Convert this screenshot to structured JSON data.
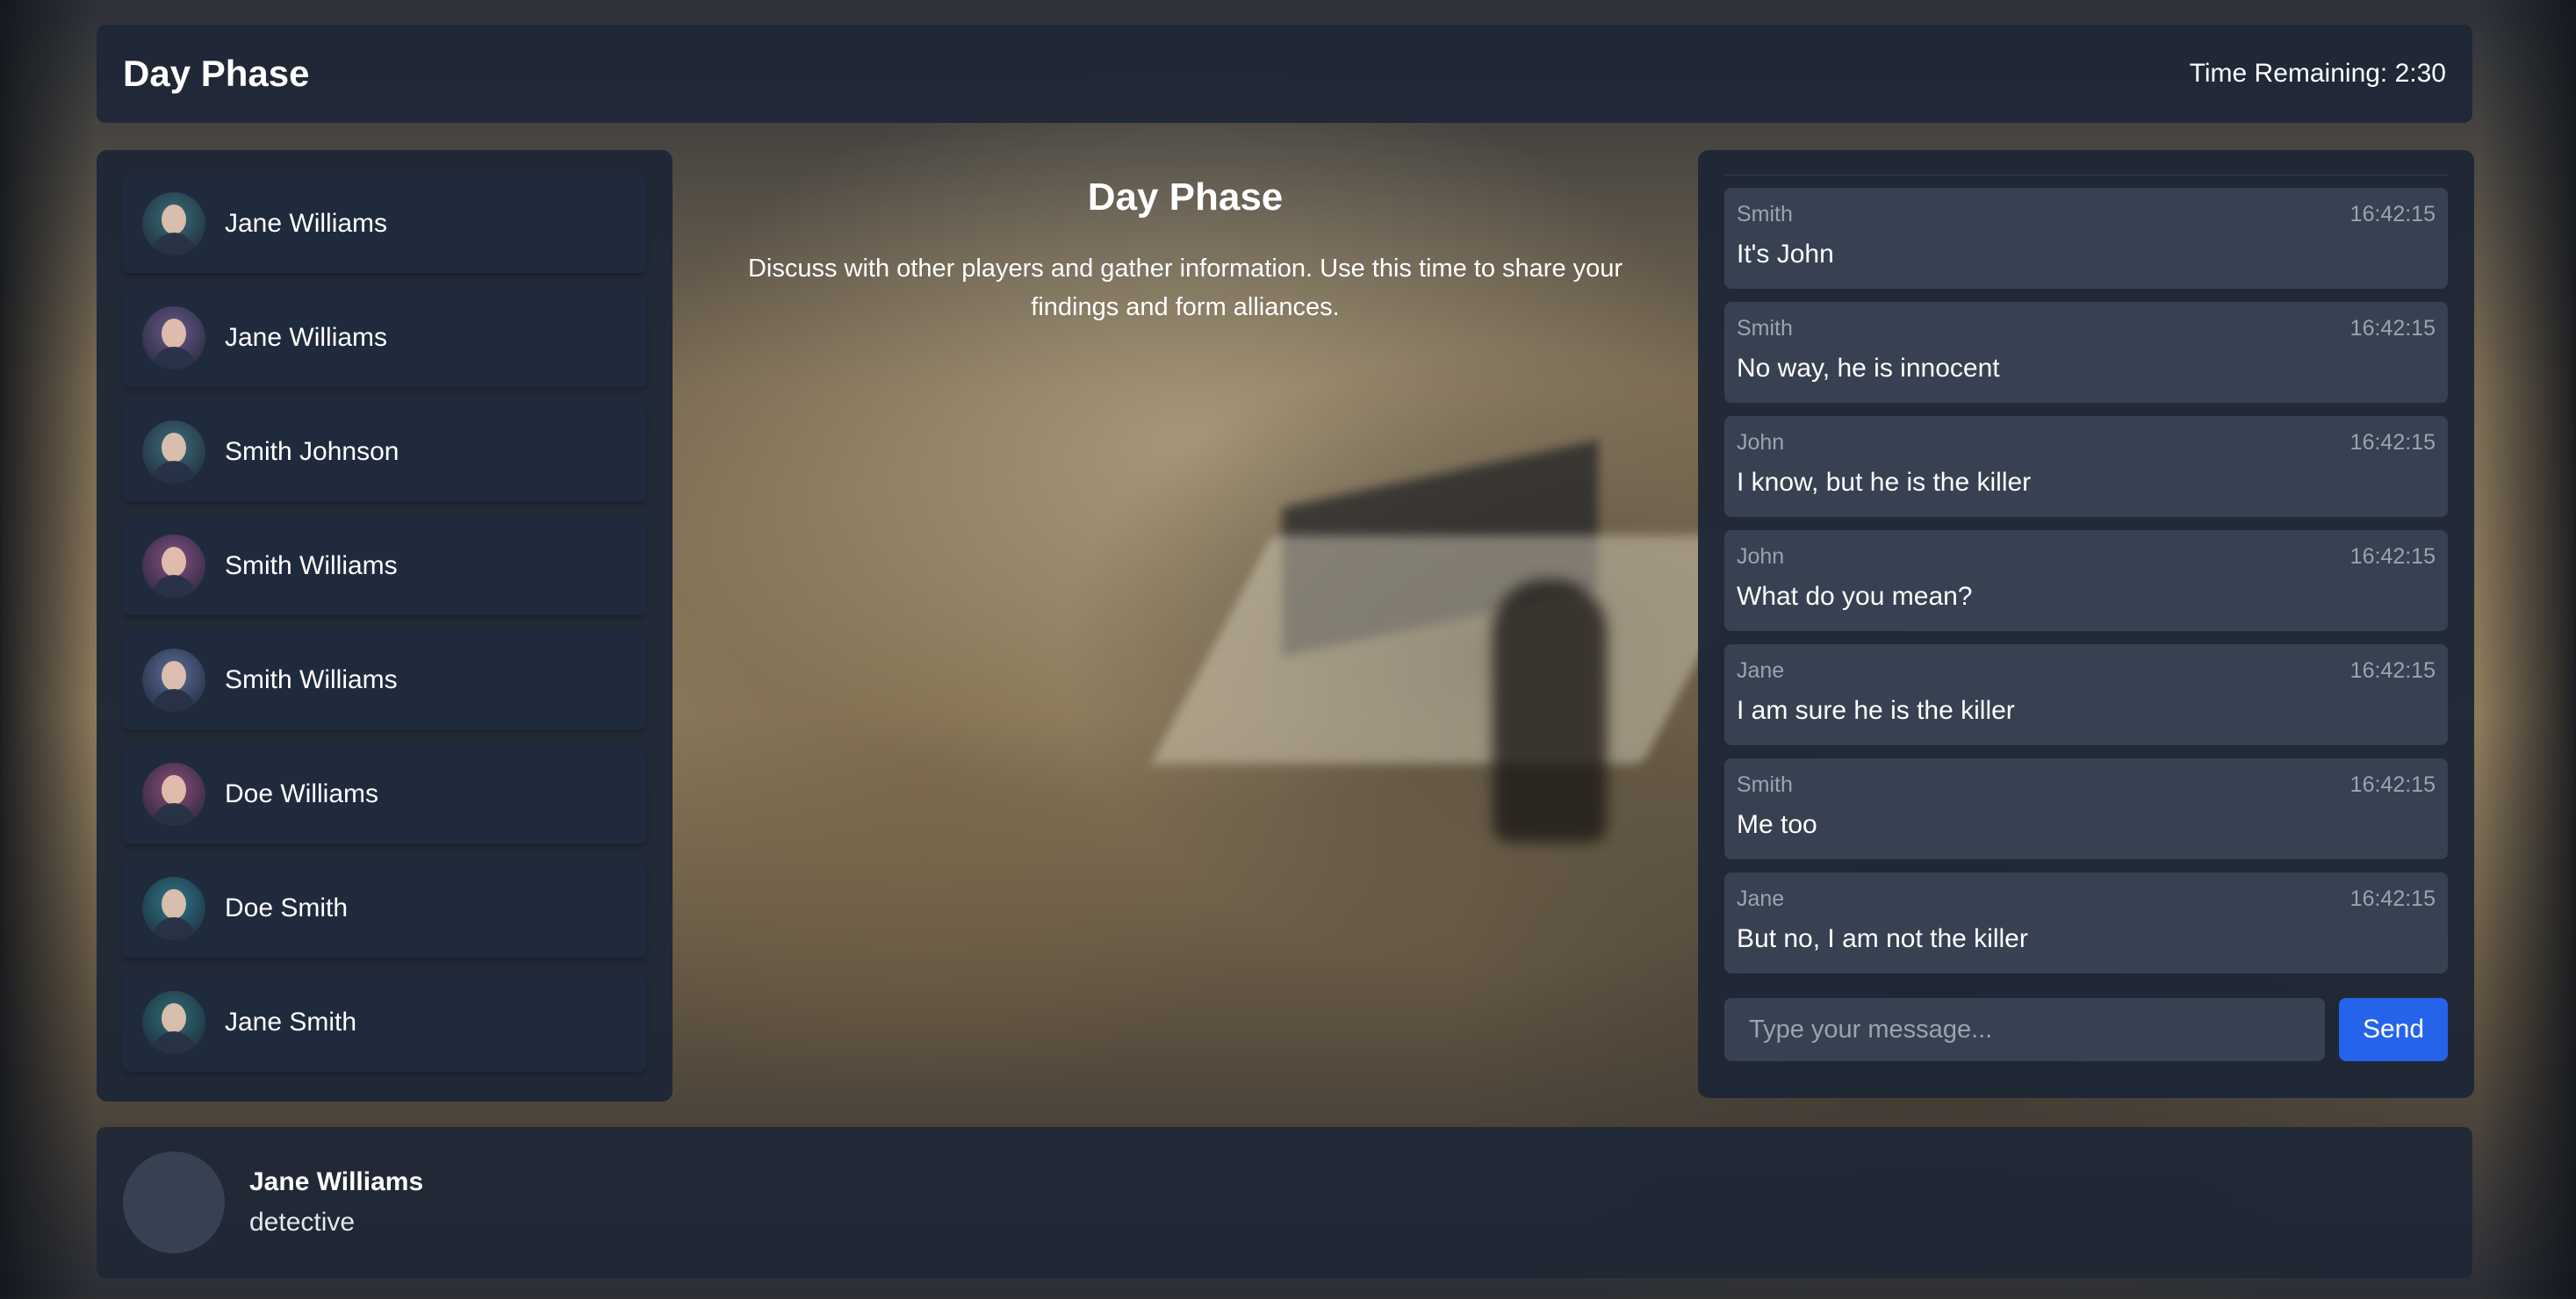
{
  "header": {
    "title": "Day Phase",
    "timer": "Time Remaining: 2:30"
  },
  "players": [
    {
      "name": "Jane Williams",
      "avatar_color": "#3a6f7a",
      "avatar_icon": "portrait-man-icon"
    },
    {
      "name": "Jane Williams",
      "avatar_color": "#6d5a8c",
      "avatar_icon": "portrait-woman-icon"
    },
    {
      "name": "Smith Johnson",
      "avatar_color": "#3f6e7c",
      "avatar_icon": "portrait-man-icon"
    },
    {
      "name": "Smith Williams",
      "avatar_color": "#8a4f86",
      "avatar_icon": "portrait-woman-icon"
    },
    {
      "name": "Smith Williams",
      "avatar_color": "#5d6f9c",
      "avatar_icon": "portrait-woman-icon"
    },
    {
      "name": "Doe Williams",
      "avatar_color": "#8f4d7a",
      "avatar_icon": "portrait-woman-icon"
    },
    {
      "name": "Doe Smith",
      "avatar_color": "#2f7a8a",
      "avatar_icon": "portrait-man-icon"
    },
    {
      "name": "Jane Smith",
      "avatar_color": "#2f6f78",
      "avatar_icon": "portrait-man-icon"
    }
  ],
  "main": {
    "title": "Day Phase",
    "description": "Discuss with other players and gather information. Use this time to share your findings and form alliances."
  },
  "chat": {
    "messages": [
      {
        "sender": "Smith",
        "time": "16:42:15",
        "text": "It's John"
      },
      {
        "sender": "Smith",
        "time": "16:42:15",
        "text": "No way, he is innocent"
      },
      {
        "sender": "John",
        "time": "16:42:15",
        "text": "I know, but he is the killer"
      },
      {
        "sender": "John",
        "time": "16:42:15",
        "text": "What do you mean?"
      },
      {
        "sender": "Jane",
        "time": "16:42:15",
        "text": "I am sure he is the killer"
      },
      {
        "sender": "Smith",
        "time": "16:42:15",
        "text": "Me too"
      },
      {
        "sender": "Jane",
        "time": "16:42:15",
        "text": "But no, I am not the killer"
      }
    ],
    "input_placeholder": "Type your message...",
    "input_value": "",
    "send_label": "Send"
  },
  "self": {
    "name": "Jane Williams",
    "role": "detective"
  },
  "colors": {
    "panel": "#1e2636",
    "card": "#374151",
    "accent": "#2563eb",
    "muted_text": "#9ca3af"
  }
}
